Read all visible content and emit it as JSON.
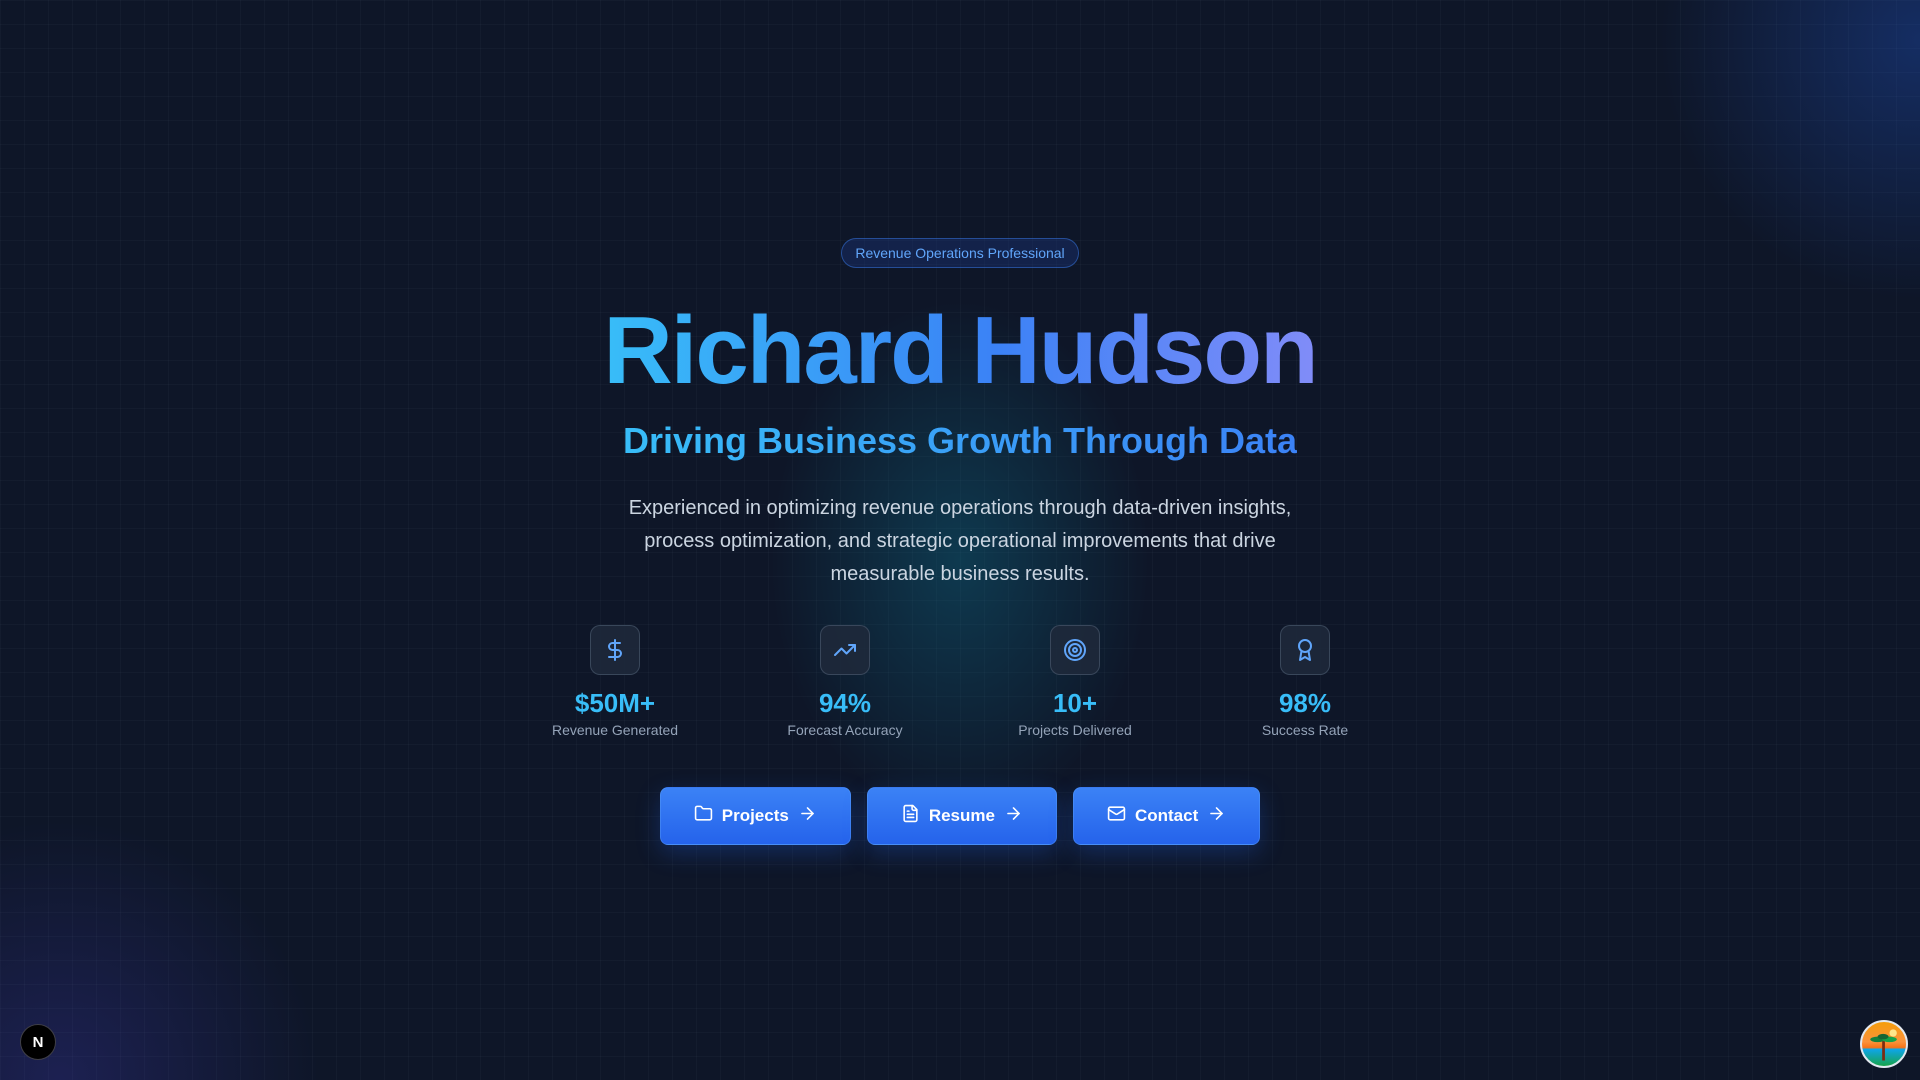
{
  "hero": {
    "badge": "Revenue Operations Professional",
    "name": "Richard Hudson",
    "tagline": "Driving Business Growth Through Data",
    "description": "Experienced in optimizing revenue operations through data-driven insights, process optimization, and strategic operational improvements that drive measurable business results."
  },
  "stats": [
    {
      "icon": "dollar-sign-icon",
      "value": "$50M+",
      "label": "Revenue Generated"
    },
    {
      "icon": "trending-up-icon",
      "value": "94%",
      "label": "Forecast Accuracy"
    },
    {
      "icon": "target-icon",
      "value": "10+",
      "label": "Projects Delivered"
    },
    {
      "icon": "award-icon",
      "value": "98%",
      "label": "Success Rate"
    }
  ],
  "actions": [
    {
      "icon": "folder-icon",
      "label": "Projects"
    },
    {
      "icon": "file-text-icon",
      "label": "Resume"
    },
    {
      "icon": "mail-icon",
      "label": "Contact"
    }
  ],
  "dev_indicator": {
    "label": "N"
  },
  "colors": {
    "background": "#0e1628",
    "accent": "#3b82f6",
    "accent_light": "#38bdf8",
    "accent_violet": "#818cf8",
    "text_muted": "#94a3b8"
  }
}
